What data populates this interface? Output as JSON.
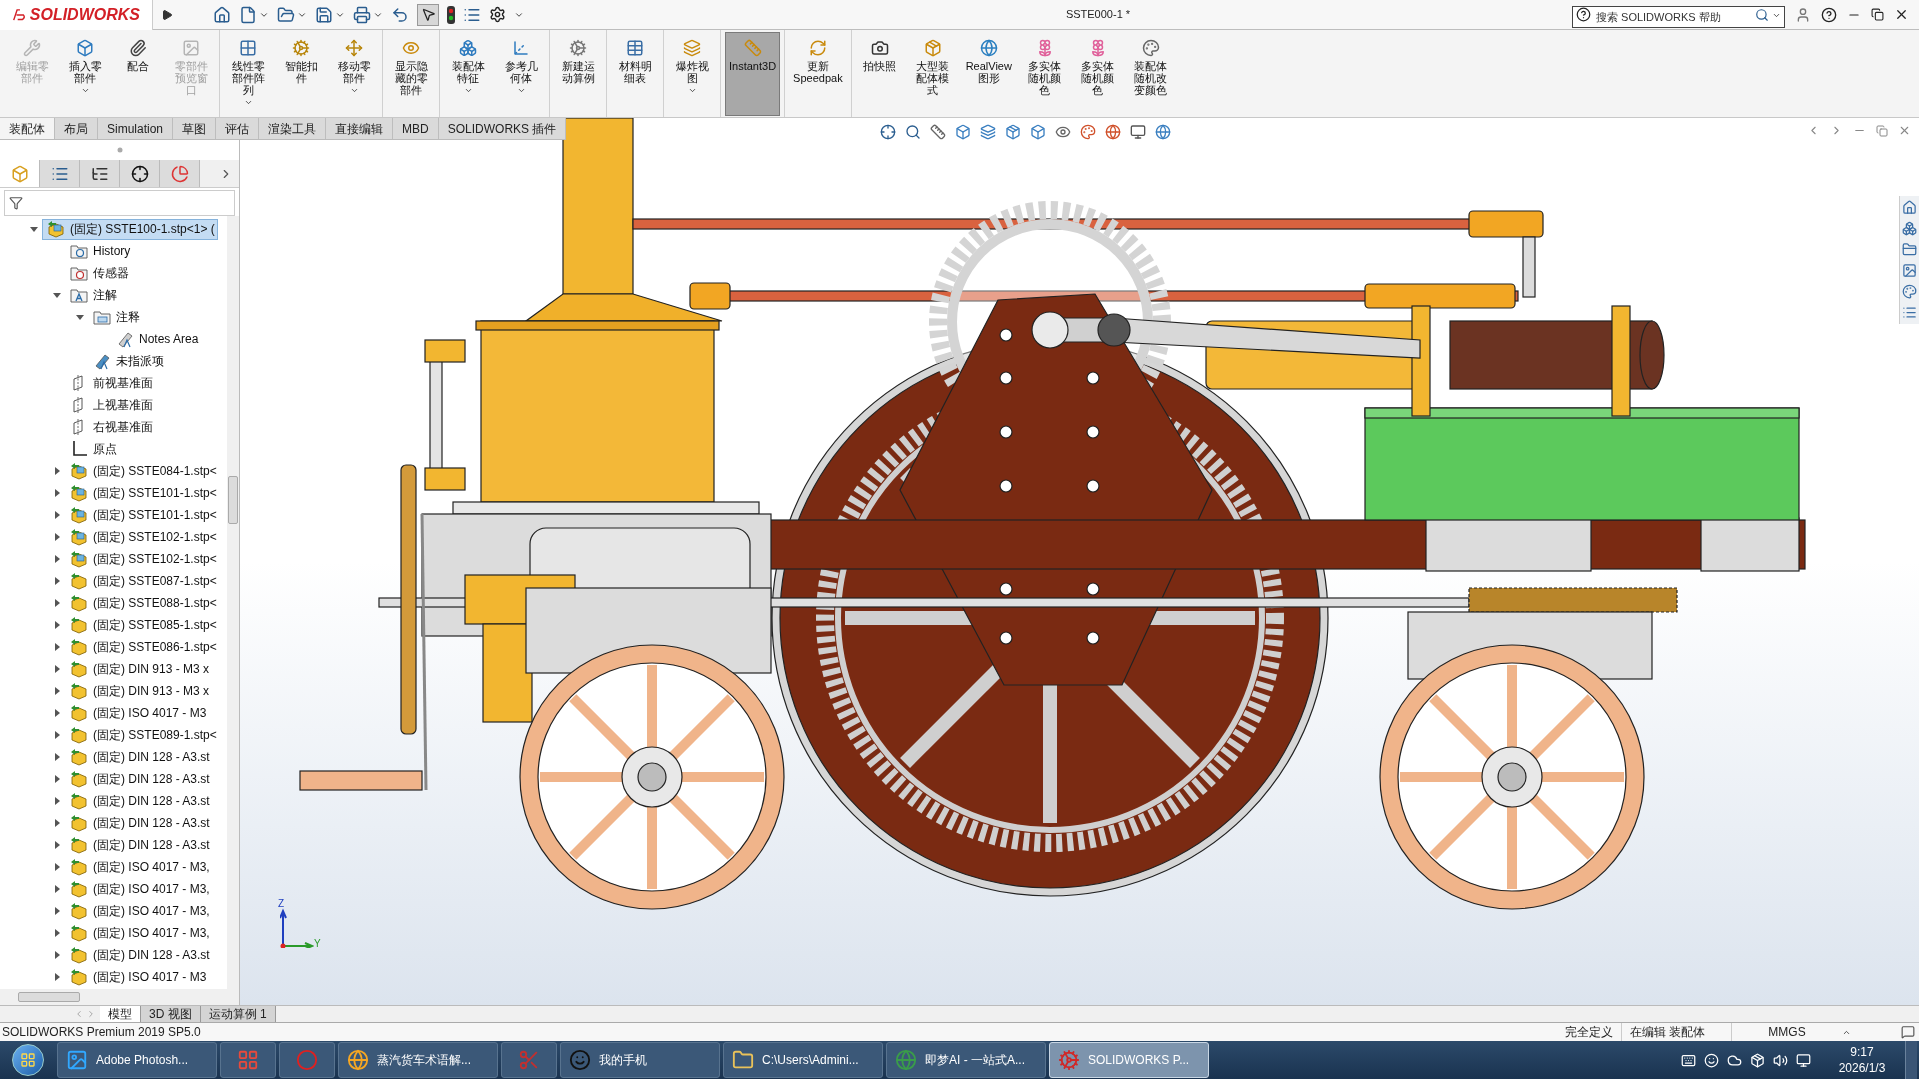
{
  "title_bar": {
    "logo": "SOLIDWORKS",
    "document_title": "SSTE000-1 *",
    "search": {
      "placeholder": "搜索 SOLIDWORKS 帮助"
    }
  },
  "ribbon": {
    "groups": [
      {
        "buttons": [
          {
            "label": "编辑零部件",
            "disabled": true,
            "selected": false,
            "dropdown": false
          },
          {
            "label": "插入零部件",
            "disabled": false,
            "selected": false,
            "dropdown": true
          },
          {
            "label": "配合",
            "disabled": false,
            "selected": false,
            "dropdown": false
          },
          {
            "label": "零部件预览窗口",
            "disabled": true,
            "selected": false,
            "dropdown": false
          }
        ]
      },
      {
        "buttons": [
          {
            "label": "线性零部件阵列",
            "disabled": false,
            "selected": false,
            "dropdown": true
          },
          {
            "label": "智能扣件",
            "disabled": false,
            "selected": false,
            "dropdown": false
          },
          {
            "label": "移动零部件",
            "disabled": false,
            "selected": false,
            "dropdown": true
          }
        ]
      },
      {
        "buttons": [
          {
            "label": "显示隐藏的零部件",
            "disabled": false,
            "selected": false,
            "dropdown": false
          }
        ]
      },
      {
        "buttons": [
          {
            "label": "装配体特征",
            "disabled": false,
            "selected": false,
            "dropdown": true
          },
          {
            "label": "参考几何体",
            "disabled": false,
            "selected": false,
            "dropdown": true
          }
        ]
      },
      {
        "buttons": [
          {
            "label": "新建运动算例",
            "disabled": false,
            "selected": false,
            "dropdown": false
          }
        ]
      },
      {
        "buttons": [
          {
            "label": "材料明细表",
            "disabled": false,
            "selected": false,
            "dropdown": false
          }
        ]
      },
      {
        "buttons": [
          {
            "label": "爆炸视图",
            "disabled": false,
            "selected": false,
            "dropdown": true
          }
        ]
      },
      {
        "buttons": [
          {
            "label": "Instant3D",
            "disabled": false,
            "selected": true,
            "dropdown": false
          }
        ]
      },
      {
        "buttons": [
          {
            "label": "更新 Speedpak",
            "disabled": false,
            "selected": false,
            "dropdown": false
          }
        ]
      },
      {
        "buttons": [
          {
            "label": "拍快照",
            "disabled": false,
            "selected": false,
            "dropdown": false
          },
          {
            "label": "大型装配体模式",
            "disabled": false,
            "selected": false,
            "dropdown": false
          },
          {
            "label": "RealView 图形",
            "disabled": false,
            "selected": false,
            "dropdown": false
          },
          {
            "label": "多实体随机颜色",
            "disabled": false,
            "selected": false,
            "dropdown": false
          },
          {
            "label": "多实体随机颜色",
            "disabled": false,
            "selected": false,
            "dropdown": false
          },
          {
            "label": "装配体随机改变颜色",
            "disabled": false,
            "selected": false,
            "dropdown": false
          }
        ]
      }
    ]
  },
  "command_tabs": [
    {
      "label": "装配体",
      "selected": true
    },
    {
      "label": "布局",
      "selected": false
    },
    {
      "label": "Simulation",
      "selected": false
    },
    {
      "label": "草图",
      "selected": false
    },
    {
      "label": "评估",
      "selected": false
    },
    {
      "label": "渲染工具",
      "selected": false
    },
    {
      "label": "直接编辑",
      "selected": false
    },
    {
      "label": "MBD",
      "selected": false
    },
    {
      "label": "SOLIDWORKS 插件",
      "selected": false
    }
  ],
  "panel_tabs": [
    {
      "selected": true
    },
    {
      "selected": false
    },
    {
      "selected": false
    },
    {
      "selected": false
    },
    {
      "selected": false
    }
  ],
  "feature_tree": {
    "items": [
      {
        "label": "(固定) SSTE100-1.stp<1> (",
        "kind": "assembly",
        "expanded": true,
        "selected": true,
        "children": [
          {
            "label": "History",
            "kind": "history",
            "selected": false
          },
          {
            "label": "传感器",
            "kind": "sensor",
            "selected": false
          },
          {
            "label": "注解",
            "kind": "annotations",
            "expanded": true,
            "selected": false,
            "children": [
              {
                "label": "注释",
                "kind": "notes",
                "expanded": true,
                "selected": false,
                "children": [
                  {
                    "label": "Notes Area",
                    "kind": "notes-area",
                    "selected": false
                  }
                ]
              },
              {
                "label": "未指派项",
                "kind": "unassigned",
                "selected": false
              }
            ]
          },
          {
            "label": "前视基准面",
            "kind": "plane",
            "selected": false
          },
          {
            "label": "上视基准面",
            "kind": "plane",
            "selected": false
          },
          {
            "label": "右视基准面",
            "kind": "plane",
            "selected": false
          },
          {
            "label": "原点",
            "kind": "origin",
            "selected": false
          },
          {
            "label": "(固定) SSTE084-1.stp<",
            "kind": "assembly",
            "expanded": false,
            "selected": false
          },
          {
            "label": "(固定) SSTE101-1.stp<",
            "kind": "assembly",
            "expanded": false,
            "selected": false
          },
          {
            "label": "(固定) SSTE101-1.stp<",
            "kind": "assembly",
            "expanded": false,
            "selected": false
          },
          {
            "label": "(固定) SSTE102-1.stp<",
            "kind": "assembly",
            "expanded": false,
            "selected": false
          },
          {
            "label": "(固定) SSTE102-1.stp<",
            "kind": "assembly",
            "expanded": false,
            "selected": false
          },
          {
            "label": "(固定) SSTE087-1.stp<",
            "kind": "part",
            "expanded": false,
            "selected": false
          },
          {
            "label": "(固定) SSTE088-1.stp<",
            "kind": "part",
            "expanded": false,
            "selected": false
          },
          {
            "label": "(固定) SSTE085-1.stp<",
            "kind": "part",
            "expanded": false,
            "selected": false
          },
          {
            "label": "(固定) SSTE086-1.stp<",
            "kind": "part",
            "expanded": false,
            "selected": false
          },
          {
            "label": "(固定) DIN 913 - M3 x",
            "kind": "part",
            "expanded": false,
            "selected": false
          },
          {
            "label": "(固定) DIN 913 - M3 x",
            "kind": "part",
            "expanded": false,
            "selected": false
          },
          {
            "label": "(固定) ISO 4017 - M3",
            "kind": "part",
            "expanded": false,
            "selected": false
          },
          {
            "label": "(固定) SSTE089-1.stp<",
            "kind": "part",
            "expanded": false,
            "selected": false
          },
          {
            "label": "(固定) DIN 128 - A3.st",
            "kind": "part",
            "expanded": false,
            "selected": false
          },
          {
            "label": "(固定) DIN 128 - A3.st",
            "kind": "part",
            "expanded": false,
            "selected": false
          },
          {
            "label": "(固定) DIN 128 - A3.st",
            "kind": "part",
            "expanded": false,
            "selected": false
          },
          {
            "label": "(固定) DIN 128 - A3.st",
            "kind": "part",
            "expanded": false,
            "selected": false
          },
          {
            "label": "(固定) DIN 128 - A3.st",
            "kind": "part",
            "expanded": false,
            "selected": false
          },
          {
            "label": "(固定) ISO 4017 - M3,",
            "kind": "part",
            "expanded": false,
            "selected": false
          },
          {
            "label": "(固定) ISO 4017 - M3,",
            "kind": "part",
            "expanded": false,
            "selected": false
          },
          {
            "label": "(固定) ISO 4017 - M3,",
            "kind": "part",
            "expanded": false,
            "selected": false
          },
          {
            "label": "(固定) ISO 4017 - M3,",
            "kind": "part",
            "expanded": false,
            "selected": false
          },
          {
            "label": "(固定) DIN 128 - A3.st",
            "kind": "part",
            "expanded": false,
            "selected": false
          },
          {
            "label": "(固定) ISO 4017 - M3",
            "kind": "part",
            "expanded": false,
            "selected": false
          }
        ]
      }
    ]
  },
  "viewport": {
    "triad": {
      "z": "Z",
      "y": "Y"
    }
  },
  "bottom_tabs": [
    {
      "label": "模型",
      "selected": true
    },
    {
      "label": "3D 视图",
      "selected": false
    },
    {
      "label": "运动算例 1",
      "selected": false
    }
  ],
  "status_bar": {
    "version": "SOLIDWORKS Premium 2019 SP5.0",
    "state": "完全定义",
    "mode": "在编辑 装配体",
    "units": "MMGS"
  },
  "taskbar": {
    "items": [
      {
        "label": "Adobe Photosh...",
        "selected": false
      },
      {
        "selected": false
      },
      {
        "selected": false
      },
      {
        "label": "蒸汽货车术语解...",
        "selected": false
      },
      {
        "selected": false
      },
      {
        "label": "我的手机",
        "selected": false
      },
      {
        "label": "C:\\Users\\Admini...",
        "selected": false
      },
      {
        "label": "即梦AI - 一站式A...",
        "selected": false
      },
      {
        "label": "SOLIDWORKS P...",
        "selected": true
      }
    ],
    "time": "9:17",
    "date": "2026/1/3"
  }
}
